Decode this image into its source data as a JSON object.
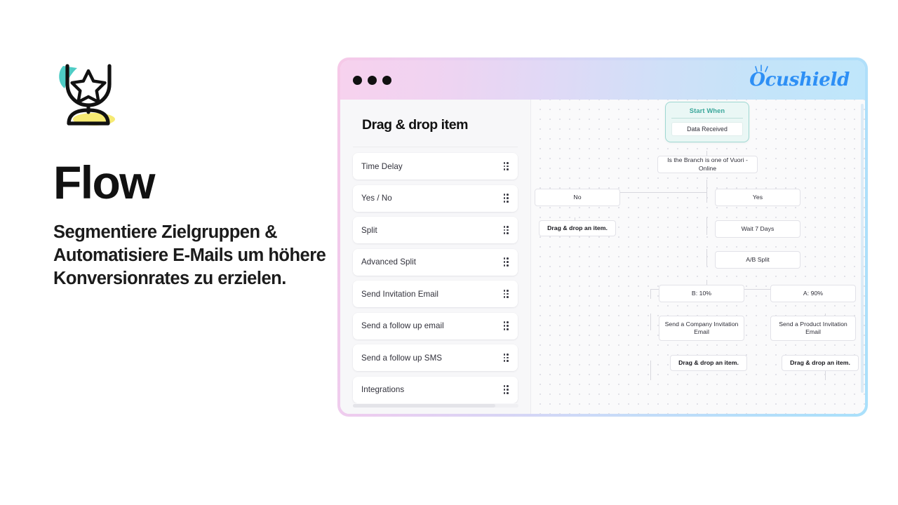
{
  "marketing": {
    "icon": "trophy-star-icon",
    "headline": "Flow",
    "subhead": "Segmentiere Zielgruppen & Automatisiere E-Mails um höhere Konversionrates zu erzielen.",
    "accent_teal": "#3fc8c0",
    "accent_yellow": "#f6e96b"
  },
  "window": {
    "titlebar": {
      "traffic_lights": [
        "close-dot",
        "minimize-dot",
        "maximize-dot"
      ],
      "brand": "Ocushield",
      "brand_color": "#2d8ff5",
      "gradient_from": "#f7d2ee",
      "gradient_to": "#bfe6fb"
    },
    "sidebar": {
      "title": "Drag & drop item",
      "items": [
        {
          "label": "Time Delay",
          "handle": "drag-handle-icon"
        },
        {
          "label": "Yes / No",
          "handle": "drag-handle-icon"
        },
        {
          "label": "Split",
          "handle": "drag-handle-icon"
        },
        {
          "label": "Advanced Split",
          "handle": "drag-handle-icon"
        },
        {
          "label": "Send Invitation Email",
          "handle": "drag-handle-icon"
        },
        {
          "label": "Send a follow up email",
          "handle": "drag-handle-icon"
        },
        {
          "label": "Send a follow up SMS",
          "handle": "drag-handle-icon"
        },
        {
          "label": "Integrations",
          "handle": "drag-handle-icon"
        }
      ]
    },
    "canvas": {
      "start_node": {
        "title": "Start When",
        "value": "Data Received",
        "accent": "#3aa79b"
      },
      "nodes": [
        {
          "id": "condition",
          "label": "Is the Branch is one of Vuori - Online",
          "bold": false
        },
        {
          "id": "branch-no",
          "label": "No",
          "bold": false
        },
        {
          "id": "branch-yes",
          "label": "Yes",
          "bold": false
        },
        {
          "id": "no-placeholder",
          "label": "Drag & drop an item.",
          "bold": true
        },
        {
          "id": "wait",
          "label": "Wait 7 Days",
          "bold": false
        },
        {
          "id": "ab-split",
          "label": "A/B Split",
          "bold": false
        },
        {
          "id": "branch-b",
          "label": "B: 10%",
          "bold": false
        },
        {
          "id": "branch-a",
          "label": "A: 90%",
          "bold": false
        },
        {
          "id": "email-company",
          "label": "Send a Company Invitation Email",
          "bold": false
        },
        {
          "id": "email-product",
          "label": "Send a Product Invitation Email",
          "bold": false
        },
        {
          "id": "b-placeholder",
          "label": "Drag & drop an item.",
          "bold": true
        },
        {
          "id": "a-placeholder",
          "label": "Drag & drop an item.",
          "bold": true
        }
      ]
    }
  }
}
